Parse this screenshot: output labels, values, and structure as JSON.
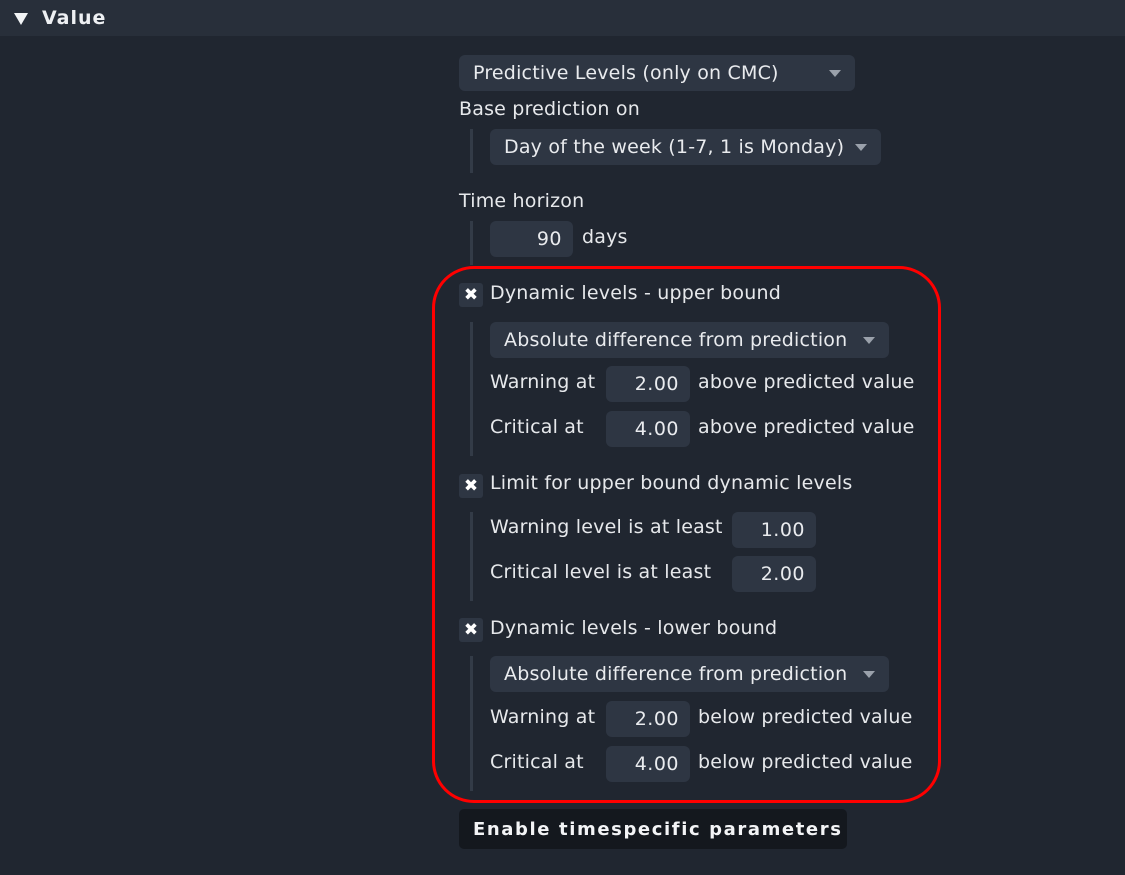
{
  "section": {
    "title": "Value",
    "collapse_icon": "triangle-down-icon"
  },
  "levels_type_select": {
    "selected": "Predictive Levels (only on CMC)"
  },
  "base_prediction": {
    "label": "Base prediction on",
    "selected": "Day of the week (1-7, 1 is Monday)"
  },
  "time_horizon": {
    "label": "Time horizon",
    "value": "90",
    "unit": "days"
  },
  "upper_bound": {
    "checkbox_icon": "x-mark-icon",
    "label": "Dynamic levels - upper bound",
    "mode_selected": "Absolute difference from prediction",
    "warning_label": "Warning at",
    "warning_value": "2.00",
    "warning_suffix": "above predicted value",
    "critical_label": "Critical at",
    "critical_value": "4.00",
    "critical_suffix": "above predicted value"
  },
  "upper_limit": {
    "checkbox_icon": "x-mark-icon",
    "label": "Limit for upper bound dynamic levels",
    "warning_label": "Warning level is at least",
    "warning_value": "1.00",
    "critical_label": "Critical level is at least",
    "critical_value": "2.00"
  },
  "lower_bound": {
    "checkbox_icon": "x-mark-icon",
    "label": "Dynamic levels - lower bound",
    "mode_selected": "Absolute difference from prediction",
    "warning_label": "Warning at",
    "warning_value": "2.00",
    "warning_suffix": "below predicted value",
    "critical_label": "Critical at",
    "critical_value": "4.00",
    "critical_suffix": "below predicted value"
  },
  "timespecific_button": {
    "label": "Enable timespecific parameters"
  },
  "colors": {
    "background": "#202630",
    "header": "#282f3a",
    "input": "#2e3643",
    "highlight": "#ff0000",
    "button": "#14181e"
  }
}
